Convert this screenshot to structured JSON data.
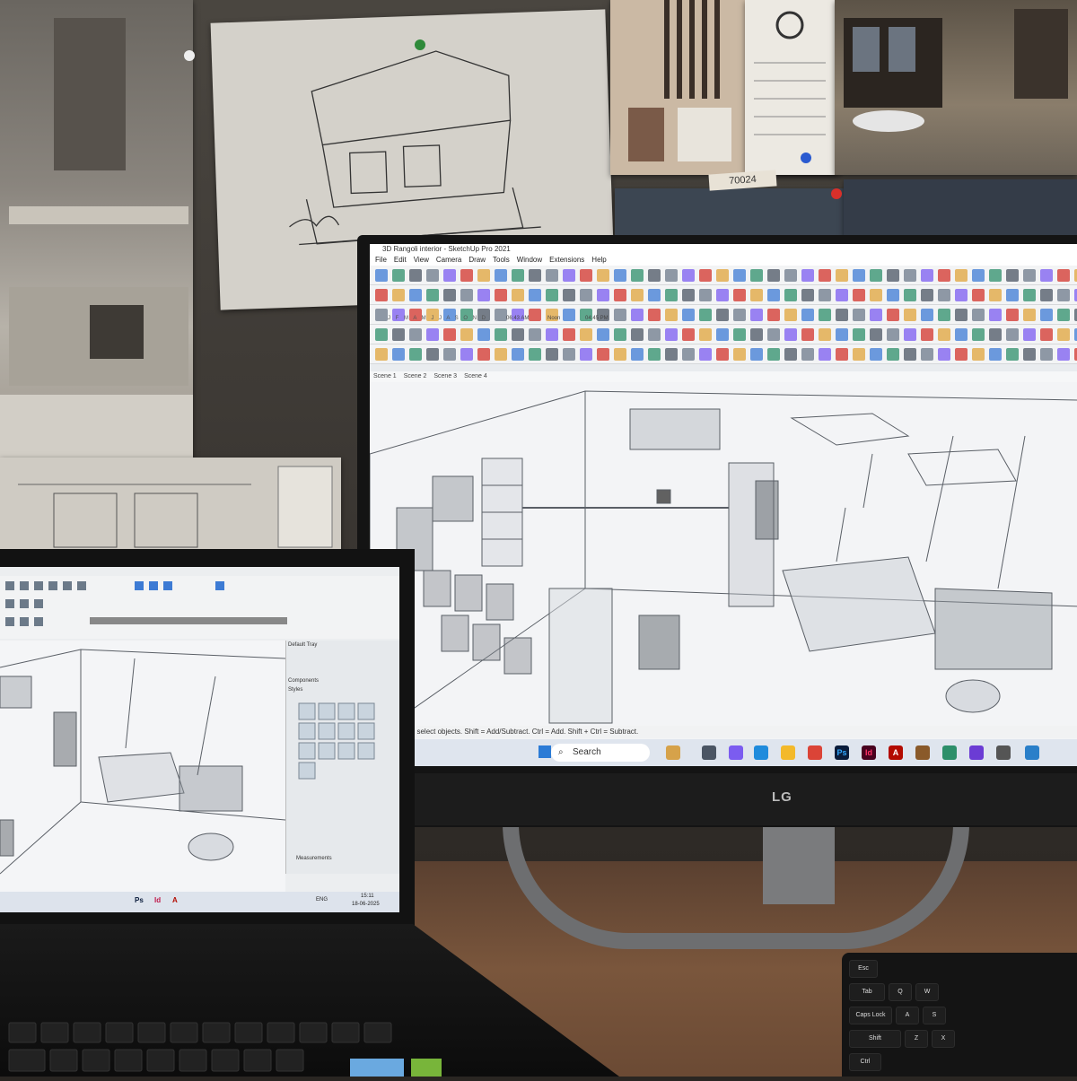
{
  "posters": {
    "tag_text": "70024"
  },
  "monitor": {
    "brand": "LG",
    "title": "3D Rangoli interior - SketchUp Pro 2021",
    "menu": [
      "File",
      "Edit",
      "View",
      "Camera",
      "Draw",
      "Tools",
      "Window",
      "Extensions",
      "Help"
    ],
    "sun_months": "J F M A M J J A S O N D",
    "sun_time_start": "06:43 AM",
    "sun_noon": "Noon",
    "sun_time_end": "04:45 PM",
    "scenes": [
      "Scene 1",
      "Scene 2",
      "Scene 3",
      "Scene 4"
    ],
    "status": "ick or drag to select objects. Shift = Add/Subtract. Ctrl = Add. Shift + Ctrl = Subtract.",
    "taskbar": {
      "search_label": "Search",
      "apps": [
        "Ps",
        "Id",
        "A"
      ]
    }
  },
  "laptop": {
    "tray_title": "Default Tray",
    "components_label": "Components",
    "styles_label": "Styles",
    "measurements_label": "Measurements",
    "clock_time": "15:11",
    "clock_date": "18-06-2025",
    "lang": "ENG",
    "taskbar_apps": [
      "Ps",
      "Id",
      "A"
    ]
  },
  "keyboard": {
    "keys": [
      "Esc",
      "Tab",
      "Caps Lock",
      "Shift",
      "Ctrl",
      "Q",
      "W",
      "A",
      "S",
      "Z",
      "X"
    ]
  },
  "colors": {
    "accent": "#3d7bd4",
    "sketchup_red": "#d3342b",
    "photoshop": "#0a1c3b",
    "indesign": "#49021f"
  }
}
